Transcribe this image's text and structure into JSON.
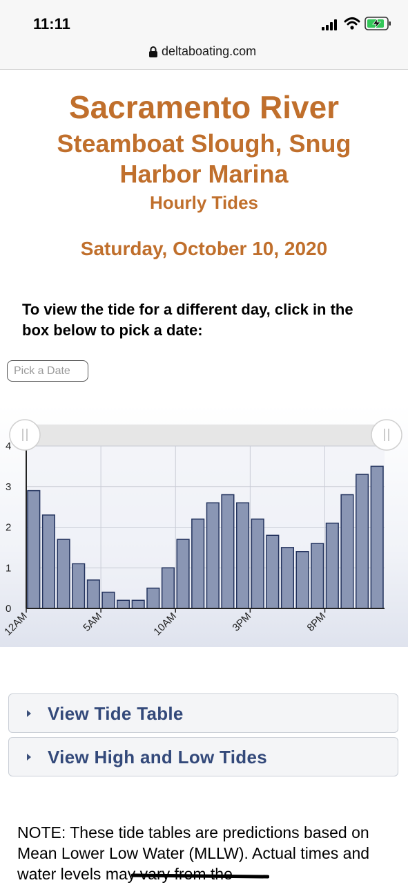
{
  "status_bar": {
    "time": "11:11",
    "icons": [
      "signal-icon",
      "wifi-icon",
      "battery-charging-icon"
    ]
  },
  "browser": {
    "url": "deltaboating.com",
    "icon": "lock-icon"
  },
  "header": {
    "river": "Sacramento River",
    "location": "Steamboat Slough, Snug Harbor Marina",
    "subtitle": "Hourly Tides",
    "date": "Saturday, October 10, 2020"
  },
  "instruction": "To view the tide for a different day, click in the box below to pick a date:",
  "date_picker": {
    "placeholder": "Pick a Date"
  },
  "colors": {
    "title": "#c06f2c",
    "bar_fill": "#8a96b4",
    "bar_stroke": "#23335e",
    "link": "#33497a"
  },
  "chart_data": {
    "type": "bar",
    "ylim": [
      0,
      4
    ],
    "yticks": [
      "0",
      "1",
      "2",
      "3",
      "4"
    ],
    "xtick_labels": [
      {
        "label": "12AM",
        "index": 0
      },
      {
        "label": "5AM",
        "index": 5
      },
      {
        "label": "10AM",
        "index": 10
      },
      {
        "label": "3PM",
        "index": 15
      },
      {
        "label": "8PM",
        "index": 20
      }
    ],
    "values": [
      2.9,
      2.3,
      1.7,
      1.1,
      0.7,
      0.4,
      0.2,
      0.2,
      0.5,
      1.0,
      1.7,
      2.2,
      2.6,
      2.8,
      2.6,
      2.2,
      1.8,
      1.5,
      1.4,
      1.6,
      2.1,
      2.8,
      3.3,
      3.5
    ],
    "grid": true,
    "range_selector": "full"
  },
  "accordions": [
    {
      "label": "View Tide Table"
    },
    {
      "label": "View High and Low Tides"
    }
  ],
  "note": "NOTE: These tide tables are predictions based on Mean Lower Low Water (MLLW). Actual times and water levels may vary from the"
}
